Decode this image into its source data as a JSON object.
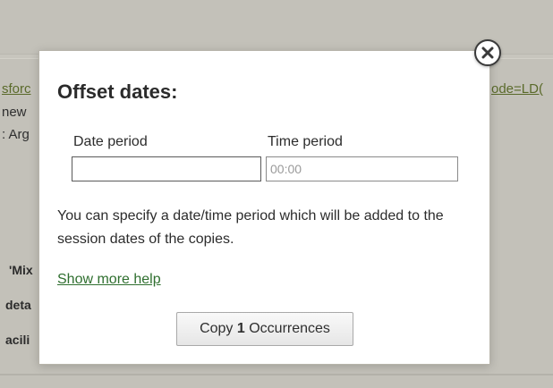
{
  "background": {
    "link_left": "sforc",
    "line_new": "new",
    "line_arg": ": Arg",
    "link_right": "ode=LD(",
    "bold_mix": "'Mix",
    "bold_deta": "deta",
    "bold_acili": "acili"
  },
  "dialog": {
    "title": "Offset dates:",
    "date_period_label": "Date period",
    "date_period_value": "",
    "time_period_label": "Time period",
    "time_period_placeholder": "00:00",
    "help_text": "You can specify a date/time period which will be added to the session dates of the copies.",
    "show_more_help": "Show more help",
    "copy_button": {
      "prefix": "Copy ",
      "count": "1",
      "suffix": " Occurrences"
    },
    "close_icon": "close-icon"
  }
}
